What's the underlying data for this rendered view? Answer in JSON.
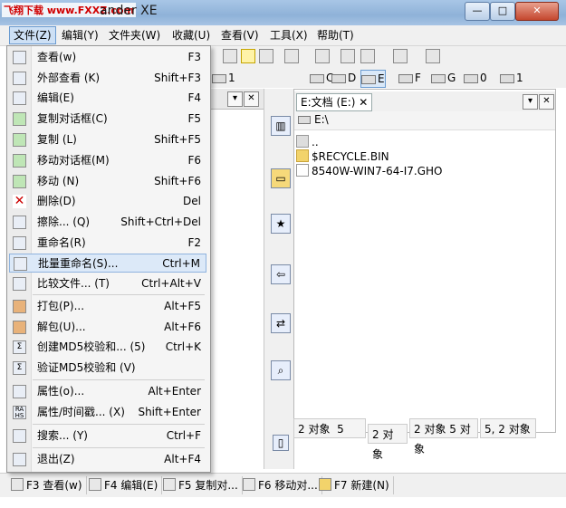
{
  "title": {
    "watermark": "飞翔下载 www.FXXZ.com",
    "app_suffix": "ander XE",
    "min": "—",
    "max": "□",
    "close": "✕"
  },
  "menubar": {
    "items": [
      "文件(Z)",
      "编辑(Y)",
      "文件夹(W)",
      "收藏(U)",
      "查看(V)",
      "工具(X)",
      "帮助(T)"
    ]
  },
  "drives_top": [
    {
      "label": "1"
    },
    {
      "label": "C"
    },
    {
      "label": "D"
    },
    {
      "label": "E"
    },
    {
      "label": "F"
    },
    {
      "label": "G"
    },
    {
      "label": "0"
    },
    {
      "label": "1"
    }
  ],
  "right_panel": {
    "tab": "E:文档 (E:)",
    "path": "E:\\",
    "files": [
      {
        "name": "..",
        "kind": "up"
      },
      {
        "name": "$RECYCLE.BIN",
        "kind": "folder"
      },
      {
        "name": "8540W-WIN7-64-I7.GHO",
        "kind": "file"
      }
    ]
  },
  "status": {
    "s1": "2 对象",
    "s2": "5",
    "s3": "2 对象",
    "s4": "2 对象 5 对象",
    "s5": "5, 2 对象"
  },
  "file_menu": [
    {
      "label": "查看(w)",
      "shortcut": "F3",
      "icon": "view-icon"
    },
    {
      "label": "外部查看 (K)",
      "shortcut": "Shift+F3",
      "icon": "external-view-icon"
    },
    {
      "label": "编辑(E)",
      "shortcut": "F4",
      "icon": "edit-icon"
    },
    {
      "label": "复制对话框(C)",
      "shortcut": "F5",
      "icon": "copy-dialog-icon"
    },
    {
      "label": "复制 (L)",
      "shortcut": "Shift+F5",
      "icon": "copy-icon"
    },
    {
      "label": "移动对话框(M)",
      "shortcut": "F6",
      "icon": "move-dialog-icon"
    },
    {
      "label": "移动 (N)",
      "shortcut": "Shift+F6",
      "icon": "move-icon"
    },
    {
      "label": "删除(D)",
      "shortcut": "Del",
      "icon": "delete-icon"
    },
    {
      "label": "擦除... (Q)",
      "shortcut": "Shift+Ctrl+Del",
      "icon": "wipe-icon"
    },
    {
      "label": "重命名(R)",
      "shortcut": "F2",
      "icon": "rename-icon"
    },
    {
      "label": "批量重命名(S)...",
      "shortcut": "Ctrl+M",
      "icon": "batch-rename-icon"
    },
    {
      "label": "比较文件... (T)",
      "shortcut": "Ctrl+Alt+V",
      "icon": "compare-icon"
    },
    {
      "label": "打包(P)...",
      "shortcut": "Alt+F5",
      "icon": "pack-icon"
    },
    {
      "label": "解包(U)...",
      "shortcut": "Alt+F6",
      "icon": "unpack-icon"
    },
    {
      "label": "创建MD5校验和... (5)",
      "shortcut": "Ctrl+K",
      "icon": "md5-create-icon"
    },
    {
      "label": "验证MD5校验和 (V)",
      "shortcut": "",
      "icon": "md5-verify-icon"
    },
    {
      "label": "属性(o)...",
      "shortcut": "Alt+Enter",
      "icon": "properties-icon"
    },
    {
      "label": "属性/时间戳... (X)",
      "shortcut": "Shift+Enter",
      "icon": "attributes-icon"
    },
    {
      "label": "搜索... (Y)",
      "shortcut": "Ctrl+F",
      "icon": "search-icon"
    },
    {
      "label": "退出(Z)",
      "shortcut": "Alt+F4",
      "icon": "exit-icon"
    }
  ],
  "fkeys": [
    {
      "label": "F3 查看(w)"
    },
    {
      "label": "F4 编辑(E)"
    },
    {
      "label": "F5 复制对..."
    },
    {
      "label": "F6 移动对..."
    },
    {
      "label": "F7 新建(N)"
    }
  ]
}
